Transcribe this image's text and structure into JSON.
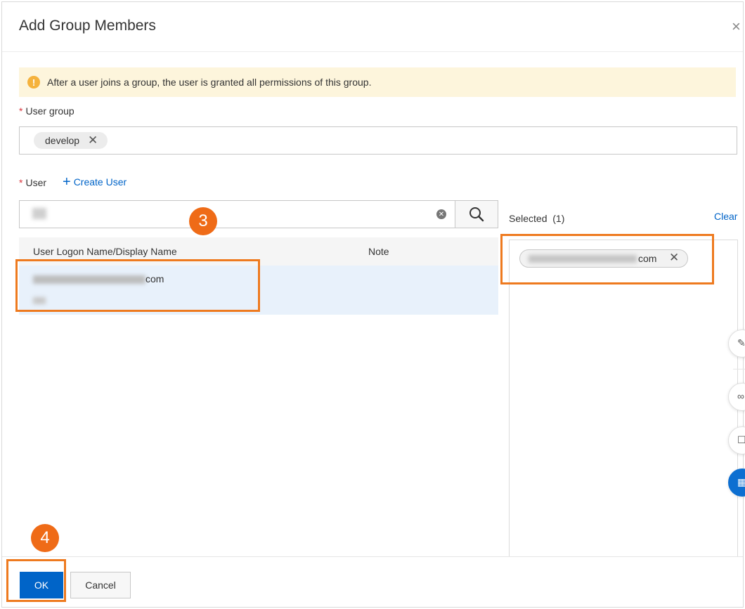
{
  "dialog": {
    "title": "Add Group Members",
    "close_glyph": "×"
  },
  "alert": {
    "icon": "warning-icon",
    "text": "After a user joins a group, the user is granted all permissions of this group."
  },
  "user_group": {
    "required_mark": "*",
    "label": "User group",
    "tags": [
      "develop"
    ]
  },
  "user": {
    "required_mark": "*",
    "label": "User",
    "create_user_label": "Create User",
    "search_value": "",
    "columns": [
      "User Logon Name/Display Name",
      "Note"
    ],
    "rows": [
      {
        "name_suffix": "com",
        "note": ""
      }
    ]
  },
  "selected": {
    "label": "Selected",
    "count": "(1)",
    "clear_label": "Clear",
    "items": [
      {
        "suffix": "com"
      }
    ]
  },
  "footer": {
    "ok_label": "OK",
    "cancel_label": "Cancel"
  },
  "annotations": {
    "step3": "3",
    "step4": "4",
    "highlight_color": "#ee7a1f",
    "badge_color": "#ef6b17"
  },
  "colors": {
    "primary": "#0064c8",
    "link": "#0064c8",
    "alert_bg": "#fdf5dc",
    "selected_row_bg": "#e8f1fb"
  }
}
